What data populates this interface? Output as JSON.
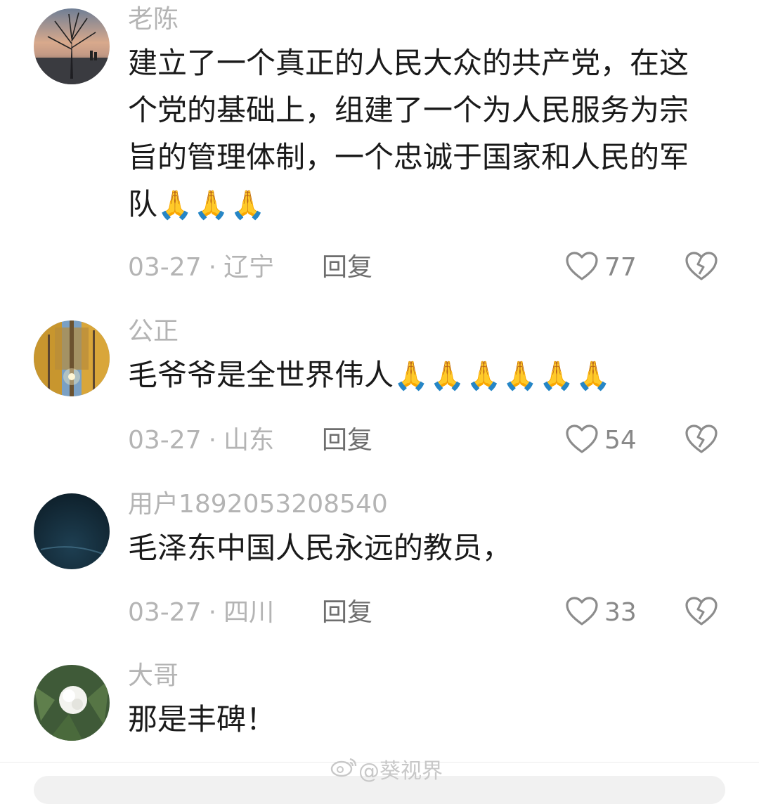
{
  "comments": [
    {
      "username": "老陈",
      "text": "建立了一个真正的人民大众的共产党，在这个党的基础上，组建了一个为人民服务为宗旨的管理体制，一个忠诚于国家和人民的军队",
      "emoji": "🙏🙏🙏",
      "date": "03-27",
      "dot": "·",
      "location": "辽宁",
      "reply_label": "回复",
      "likes": "77"
    },
    {
      "username": "公正",
      "text": "毛爷爷是全世界伟人",
      "emoji": "🙏🙏🙏🙏🙏🙏",
      "date": "03-27",
      "dot": "·",
      "location": "山东",
      "reply_label": "回复",
      "likes": "54"
    },
    {
      "username": "用户1892053208540",
      "text": "毛泽东中国人民永远的教员，",
      "emoji": "",
      "date": "03-27",
      "dot": "·",
      "location": "四川",
      "reply_label": "回复",
      "likes": "33"
    },
    {
      "username": "大哥",
      "text": "那是丰碑！",
      "emoji": ""
    }
  ],
  "watermark": "@葵视界",
  "icons": {
    "like": "heart-outline-icon",
    "dislike": "broken-heart-icon",
    "watermark": "weibo-logo-icon"
  },
  "colors": {
    "meta_gray": "#b4b4b4",
    "text": "#1a1a1a",
    "icon_gray": "#8c8c8c"
  }
}
